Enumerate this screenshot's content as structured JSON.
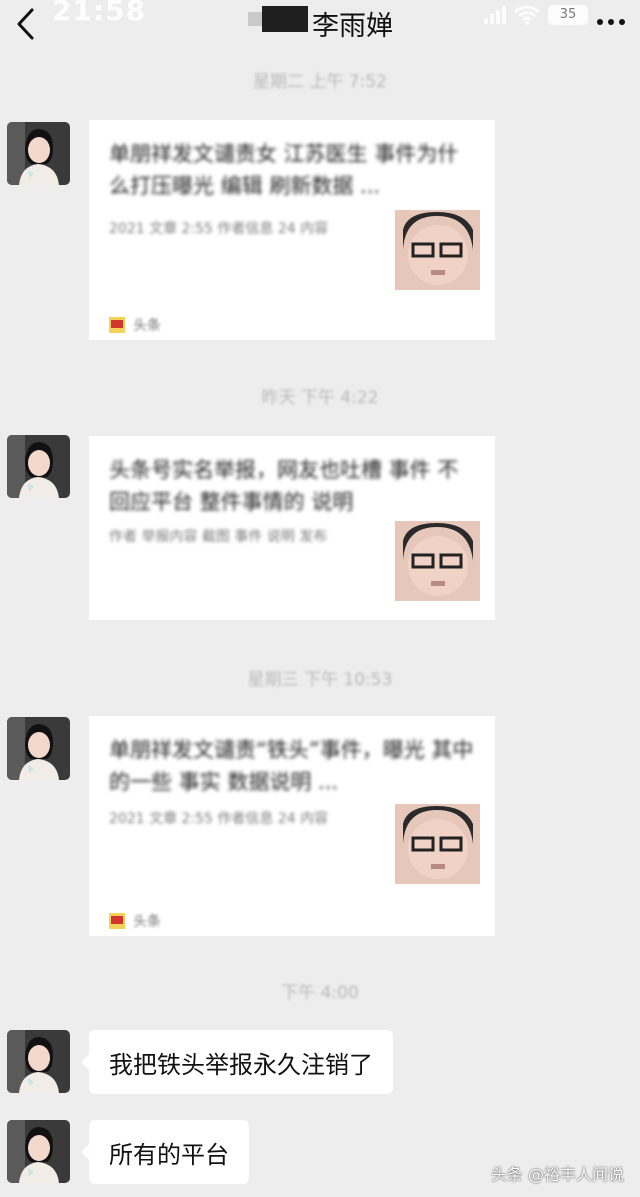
{
  "status_bar": {
    "time": "21:58",
    "battery": "35"
  },
  "header": {
    "title": "李雨婵"
  },
  "messages": [
    {
      "type": "card",
      "timestamp": "星期二 上午 7:52",
      "title": "单朋祥发文谴责女 江苏医生 事件为什么打压曝光 编辑 刷新数据 ...",
      "desc": "2021 文章 2:55 作者信息 24 内容",
      "source": "头条"
    },
    {
      "type": "card",
      "timestamp": "昨天 下午 4:22",
      "title": "头条号实名举报，网友也吐槽 事件 不回应平台 整件事情的 说明",
      "desc": "作者 举报内容 截图 事件 说明 发布"
    },
    {
      "type": "card",
      "timestamp": "星期三 下午 10:53",
      "title": "单朋祥发文谴责“铁头”事件，曝光 其中的一些 事实 数据说明 ...",
      "desc": "2021 文章 2:55 作者信息 24 内容",
      "source": "头条"
    },
    {
      "type": "text",
      "timestamp": "下午 4:00",
      "text": "我把铁头举报永久注销了"
    },
    {
      "type": "text",
      "text": "所有的平台"
    }
  ],
  "watermark": "头条 @裕丰人间说",
  "colors": {
    "background": "#ededed",
    "bubble": "#ffffff",
    "timestamp": "#b9b9b9"
  },
  "icons": {
    "back": "chevron-left-icon",
    "more": "more-dots-icon",
    "signal": "signal-icon",
    "wifi": "wifi-icon",
    "battery": "battery-icon",
    "source": "toutiao-logo-icon"
  }
}
